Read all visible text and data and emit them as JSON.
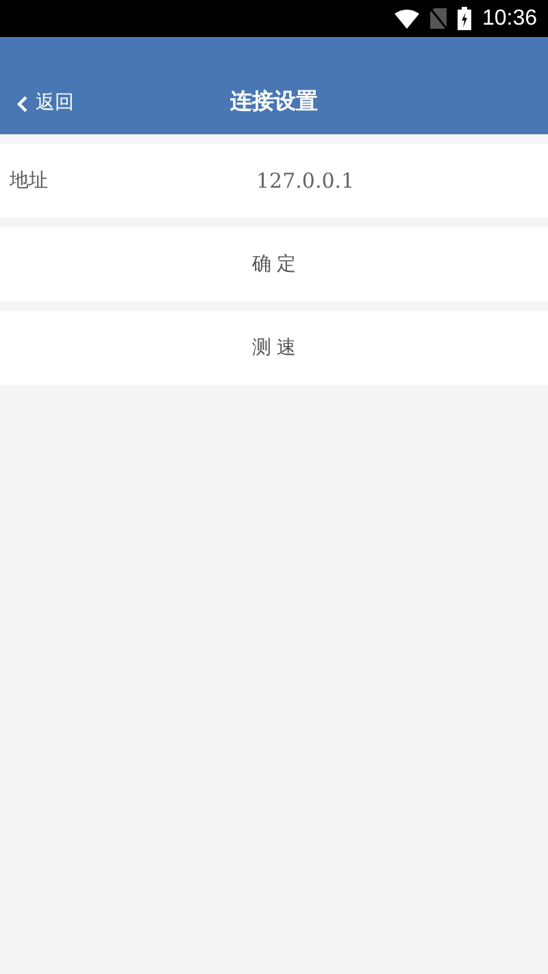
{
  "status_bar": {
    "time": "10:36"
  },
  "header": {
    "back": "返回",
    "title": "连接设置"
  },
  "address": {
    "label": "地址",
    "value": "127.0.0.1"
  },
  "buttons": [
    "确 定",
    "测 速"
  ]
}
